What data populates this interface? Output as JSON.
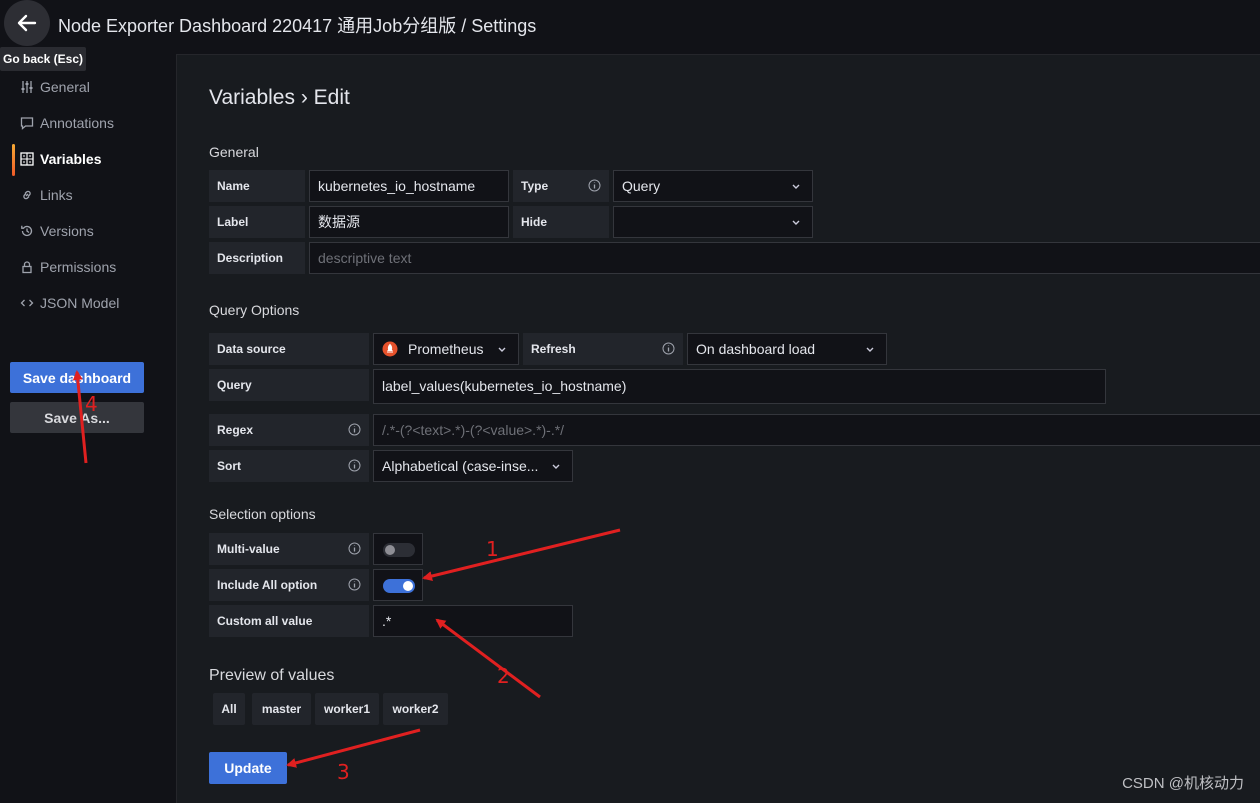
{
  "header": {
    "title": "Node Exporter Dashboard 220417 通用Job分组版 / Settings",
    "back_tooltip": "Go back (Esc)"
  },
  "sidebar": {
    "items": [
      {
        "label": "General",
        "icon": "sliders-icon"
      },
      {
        "label": "Annotations",
        "icon": "comment-icon"
      },
      {
        "label": "Variables",
        "icon": "calculator-icon",
        "active": true
      },
      {
        "label": "Links",
        "icon": "link-icon"
      },
      {
        "label": "Versions",
        "icon": "history-icon"
      },
      {
        "label": "Permissions",
        "icon": "lock-icon"
      },
      {
        "label": "JSON Model",
        "icon": "code-icon"
      }
    ],
    "save_dashboard": "Save dashboard",
    "save_as": "Save As..."
  },
  "page": {
    "heading": "Variables › Edit",
    "general": {
      "section": "General",
      "name_label": "Name",
      "name_value": "kubernetes_io_hostname",
      "type_label": "Type",
      "type_value": "Query",
      "label_label": "Label",
      "label_value": "数据源",
      "hide_label": "Hide",
      "hide_value": "",
      "description_label": "Description",
      "description_placeholder": "descriptive text"
    },
    "query_options": {
      "section": "Query Options",
      "datasource_label": "Data source",
      "datasource_value": "Prometheus",
      "refresh_label": "Refresh",
      "refresh_value": "On dashboard load",
      "query_label": "Query",
      "query_value": "label_values(kubernetes_io_hostname)",
      "regex_label": "Regex",
      "regex_value": "/.*-(?<text>.*)-(?<value>.*)-.*/",
      "sort_label": "Sort",
      "sort_value": "Alphabetical (case-inse..."
    },
    "selection": {
      "section": "Selection options",
      "multi_label": "Multi-value",
      "multi_on": false,
      "include_all_label": "Include All option",
      "include_all_on": true,
      "custom_all_label": "Custom all value",
      "custom_all_value": ".*"
    },
    "preview": {
      "section": "Preview of values",
      "values": [
        "All",
        "master",
        "worker1",
        "worker2"
      ]
    },
    "update_label": "Update"
  },
  "annotations": [
    "1",
    "2",
    "3",
    "4"
  ],
  "watermark": "CSDN @机核动力",
  "colors": {
    "accent": "#3d71d9",
    "annotation": "#e02020",
    "active_bar": "#f7a935"
  }
}
